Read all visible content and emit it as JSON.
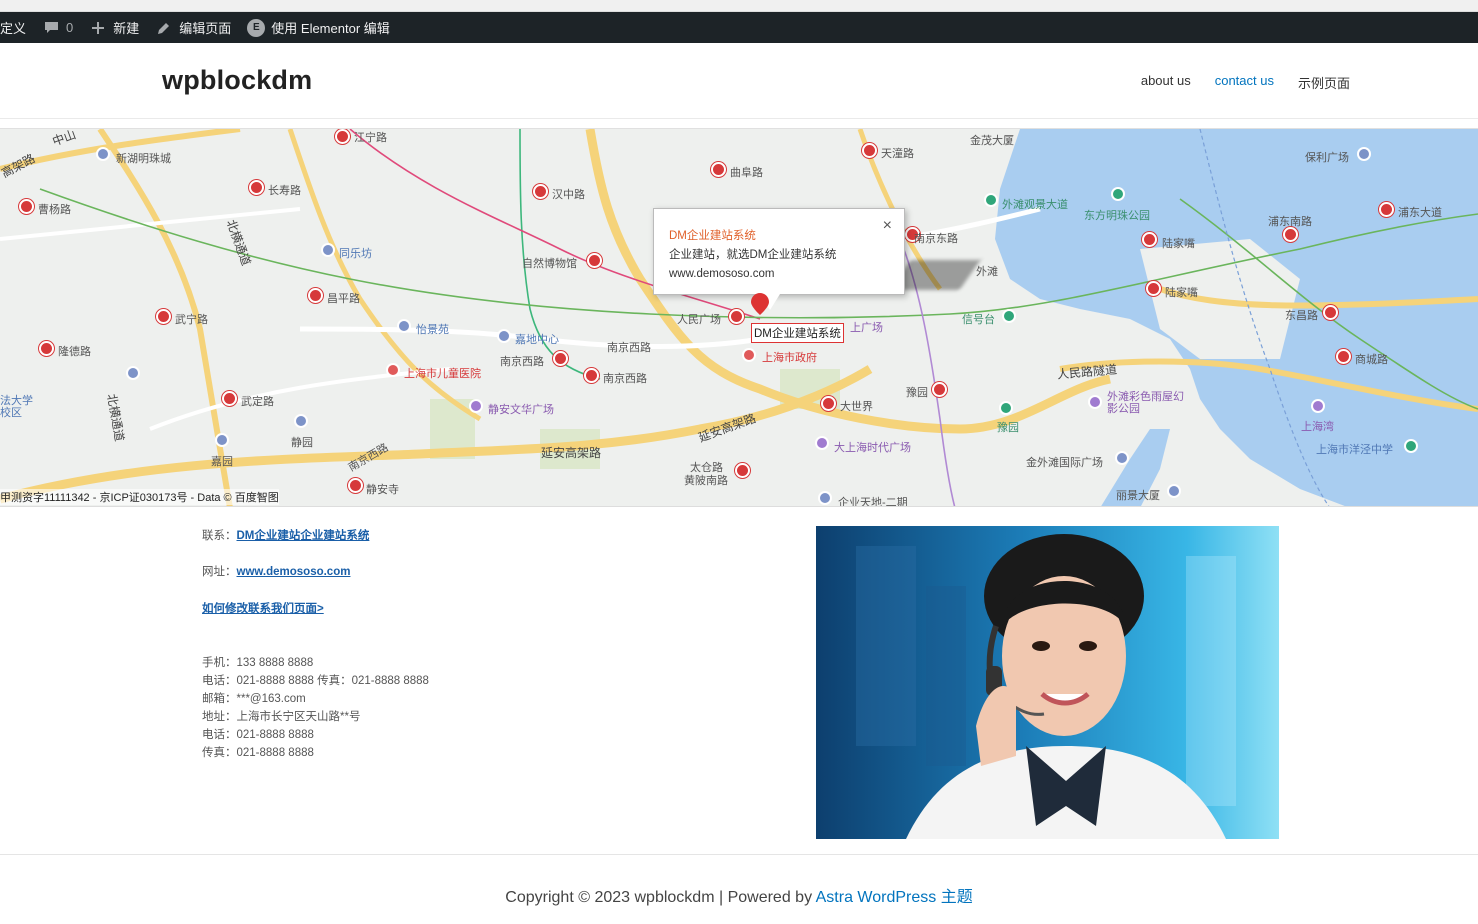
{
  "admin_bar": {
    "customize_label": "定义",
    "comments_count": "0",
    "new_label": "新建",
    "edit_page_label": "编辑页面",
    "elementor_label": "使用 Elementor 编辑",
    "elementor_icon_text": "E"
  },
  "header": {
    "site_title": "wpblockdm",
    "nav": [
      {
        "label": "about us",
        "active": false
      },
      {
        "label": "contact us",
        "active": true
      },
      {
        "label": "示例页面",
        "active": false
      }
    ]
  },
  "map": {
    "info_window": {
      "title": "DM企业建站系统",
      "line1": "企业建站，就选DM企业建站系统",
      "line2": "www.demososo.com",
      "close": "×"
    },
    "marker_label": "DM企业建站系统",
    "copyright": "甲测资字11111342 - 京ICP证030173号 - Data © 百度智图",
    "labels": {
      "zhongshan": "中山",
      "gaojia": "高架路",
      "jiangning": "江宁路",
      "tiantong": "天潼路",
      "jinmao": "金茂大厦",
      "baoli": "保利广场",
      "xinhu": "新湖明珠城",
      "changshou": "长寿路",
      "hanzhong": "汉中路",
      "qufu": "曲阜路",
      "caoyang": "曹杨路",
      "beiheng": "北横通道",
      "waitan_view": "外滩观景大道",
      "dongfang": "东方明珠公园",
      "pudong_dadao": "浦东大道",
      "pudong_nanlu": "浦东南路",
      "tongle": "同乐坊",
      "ziran": "自然博物馆",
      "nanjing_donglu": "南京东路",
      "lujiazui1": "陆家嘴",
      "waitan": "外滩",
      "changping": "昌平路",
      "lujiazui2": "陆家嘴",
      "wuning": "武宁路",
      "yijing": "怡景苑",
      "jiadi": "嘉地中心",
      "renmin": "人民广场",
      "xinyetai": "信号台",
      "dongchang": "东昌路",
      "longde": "隆德路",
      "nanjing_xilu1": "南京西路",
      "nanjing_xilu2": "南京西路",
      "shanghai_gov": "上海市政府",
      "renmin_tunnel": "人民路隧道",
      "shangcheng": "商城路",
      "ertong": "上海市儿童医院",
      "nanjing_xilu3": "南京西路",
      "wuding": "武定路",
      "jingan_culture": "静安文华广场",
      "dashijie": "大世界",
      "yuyuan1": "豫园",
      "yuyuan2": "豫园",
      "waitan_rainbow": "外滩彩色雨屋幻影公园",
      "shanghai_wan": "上海湾",
      "yangjing": "上海市洋泾中学",
      "fada": "法大学校区",
      "jingyuan": "静园",
      "jiayuan": "嘉园",
      "yanan_gaojia1": "延安高架路",
      "yanan_gaojia2": "延安高架路",
      "dashidai": "大上海时代广场",
      "nanjing_xilu4": "南京西路",
      "taikang": "太仓路",
      "huangpi": "黄陂南路",
      "jinwai": "金外滩国际广场",
      "jingan_temple": "静安寺",
      "qiye_tiandi": "企业天地-二期",
      "lijing": "丽景大厦",
      "shidai_square": "上广场"
    }
  },
  "contact": {
    "contact_label": "联系：",
    "contact_link": "DM企业建站企业建站系统",
    "website_label": "网址：",
    "website_link": "www.demososo.com",
    "howto_link": "如何修改联系我们页面>",
    "mobile": "手机：133 8888 8888",
    "phone_fax": "电话：021-8888 8888 传真：021-8888 8888",
    "email": "邮箱：***@163.com",
    "address": "地址：上海市长宁区天山路**号",
    "phone": "电话：021-8888 8888",
    "fax": "传真：021-8888 8888"
  },
  "footer": {
    "copyright": "Copyright © 2023 wpblockdm | Powered by ",
    "theme_link": "Astra WordPress 主题"
  },
  "colors": {
    "admin_bar_bg": "#1d2327",
    "accent": "#0274be",
    "metro_red": "#d6393a",
    "info_title": "#e0602a"
  }
}
